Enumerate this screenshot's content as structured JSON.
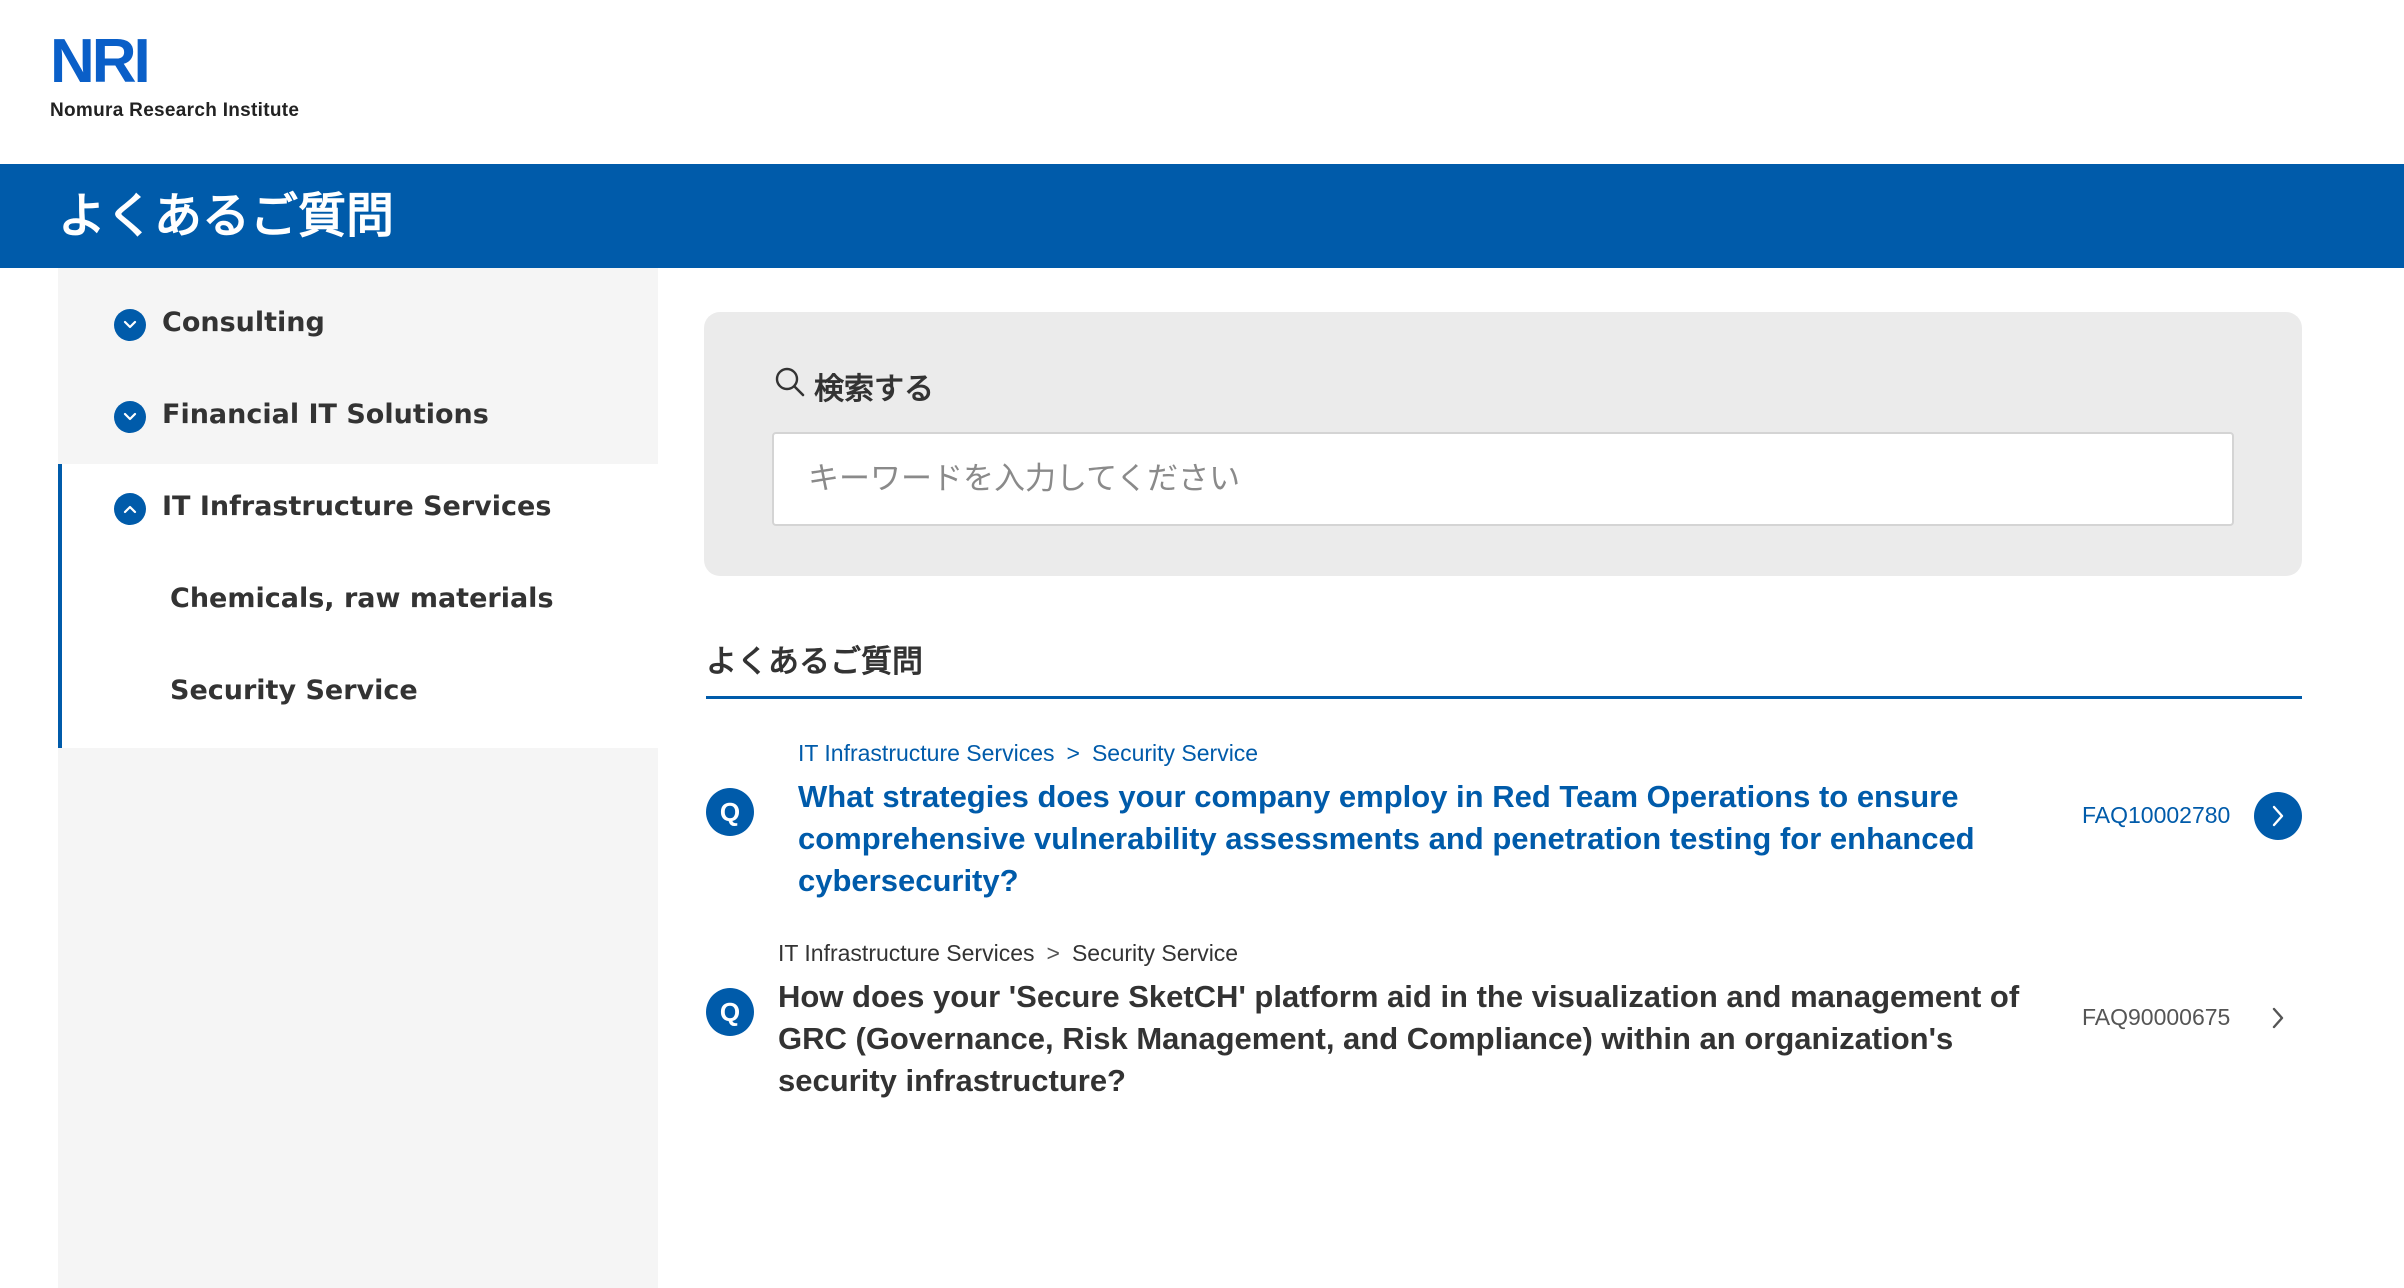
{
  "header": {
    "logo_mark": "NRI",
    "logo_subtitle": "Nomura Research Institute",
    "page_title": "よくあるご質問"
  },
  "sidebar": {
    "categories": [
      {
        "label": "Consulting",
        "expanded": false,
        "icon": "chevron-down-icon"
      },
      {
        "label": "Financial IT Solutions",
        "expanded": false,
        "icon": "chevron-down-icon"
      },
      {
        "label": "IT Infrastructure Services",
        "expanded": true,
        "icon": "chevron-up-icon"
      }
    ],
    "subcategories": [
      {
        "label": "Chemicals, raw materials"
      },
      {
        "label": "Security Service"
      }
    ]
  },
  "search": {
    "title": "検索する",
    "icon": "search-icon",
    "placeholder": "キーワードを入力してください",
    "value": ""
  },
  "faq_section": {
    "heading": "よくあるご質問",
    "items": [
      {
        "badge": "Q",
        "breadcrumb": [
          "IT Infrastructure Services",
          "Security Service"
        ],
        "breadcrumb_separator": ">",
        "question": "What strategies does your company employ in Red Team Operations to ensure comprehensive vulnerability assessments and penetration testing for enhanced cybersecurity?",
        "id": "FAQ10002780",
        "state": "hovered"
      },
      {
        "badge": "Q",
        "breadcrumb": [
          "IT Infrastructure Services",
          "Security Service"
        ],
        "breadcrumb_separator": ">",
        "question": "How does your 'Secure SketCH' platform aid in the visualization and management of GRC (Governance, Risk Management, and Compliance) within an organization's security infrastructure?",
        "id": "FAQ90000675",
        "state": "normal"
      }
    ]
  },
  "colors": {
    "brand_blue": "#005baa",
    "logo_blue": "#0a5fc8",
    "sidebar_bg": "#f5f5f5",
    "search_panel_bg": "#ebebeb",
    "text": "#333333"
  }
}
